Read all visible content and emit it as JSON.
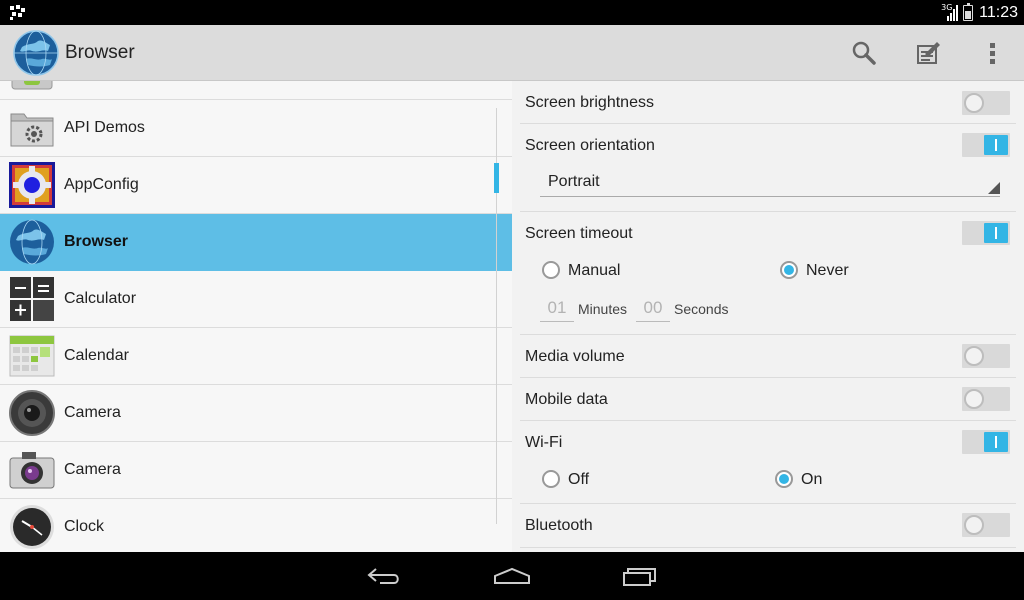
{
  "status": {
    "network": "3G",
    "time": "11:23"
  },
  "actionbar": {
    "title": "Browser",
    "icons": [
      "search-icon",
      "edit-icon",
      "overflow-menu-icon"
    ]
  },
  "app_list": [
    {
      "label": "",
      "icon": "android-folder-icon"
    },
    {
      "label": "API Demos",
      "icon": "api-demos-folder-icon"
    },
    {
      "label": "AppConfig",
      "icon": "gear-icon"
    },
    {
      "label": "Browser",
      "icon": "globe-icon",
      "selected": true
    },
    {
      "label": "Calculator",
      "icon": "calculator-icon"
    },
    {
      "label": "Calendar",
      "icon": "calendar-icon"
    },
    {
      "label": "Camera",
      "icon": "camera-lens-icon"
    },
    {
      "label": "Camera",
      "icon": "camera-icon"
    },
    {
      "label": "Clock",
      "icon": "clock-icon"
    }
  ],
  "settings": {
    "brightness": {
      "label": "Screen brightness",
      "enabled": false
    },
    "orientation": {
      "label": "Screen orientation",
      "enabled": true,
      "value": "Portrait"
    },
    "timeout": {
      "label": "Screen timeout",
      "enabled": true,
      "option_manual": "Manual",
      "option_never": "Never",
      "selected": "Never",
      "minutes_value": "01",
      "minutes_unit": "Minutes",
      "seconds_value": "00",
      "seconds_unit": "Seconds"
    },
    "media_volume": {
      "label": "Media volume",
      "enabled": false
    },
    "mobile_data": {
      "label": "Mobile data",
      "enabled": false
    },
    "wifi": {
      "label": "Wi-Fi",
      "enabled": true,
      "option_off": "Off",
      "option_on": "On",
      "selected": "On"
    },
    "bluetooth": {
      "label": "Bluetooth",
      "enabled": false
    }
  },
  "navbar": {
    "icons": [
      "back-icon",
      "home-icon",
      "recents-icon"
    ]
  },
  "colors": {
    "accent": "#33b5e5",
    "selected_row": "#5ebee6"
  }
}
